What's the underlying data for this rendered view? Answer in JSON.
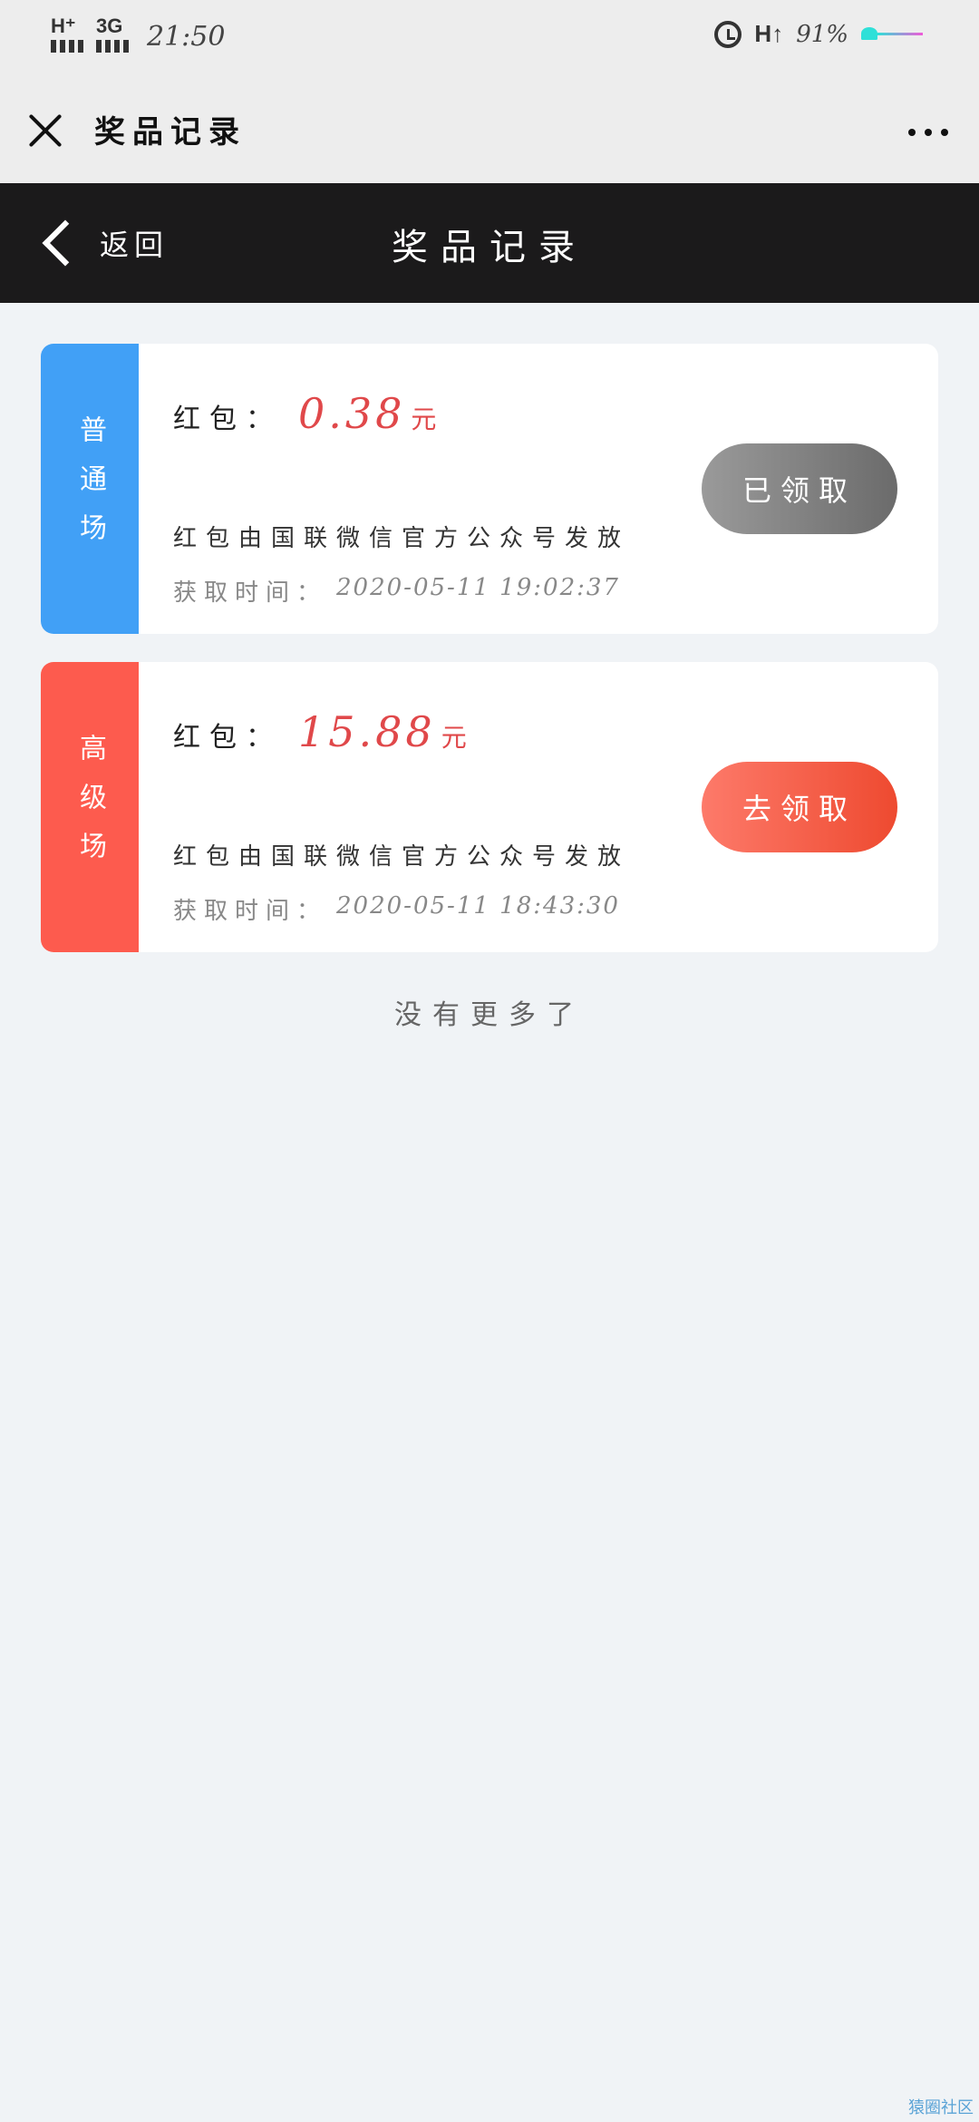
{
  "status_bar": {
    "signal1_label": "H⁺",
    "signal2_label": "3G",
    "time": "21:50",
    "network": "H↑",
    "battery": "91%"
  },
  "titlebar": {
    "title": "奖品记录",
    "close_icon": "close-icon",
    "more_icon": "more-icon"
  },
  "header": {
    "back_label": "返回",
    "title": "奖品记录"
  },
  "records": [
    {
      "tier": "普通场",
      "tier_color": "#41a0f6",
      "amount_label": "红包：",
      "amount": "0.38",
      "unit": "元",
      "issuer": "红包由国联微信官方公众号发放",
      "time_label": "获取时间：",
      "time": "2020-05-11 19:02:37",
      "button": "已领取",
      "button_state": "claimed"
    },
    {
      "tier": "高级场",
      "tier_color": "#fd5b4e",
      "amount_label": "红包：",
      "amount": "15.88",
      "unit": "元",
      "issuer": "红包由国联微信官方公众号发放",
      "time_label": "获取时间：",
      "time": "2020-05-11 18:43:30",
      "button": "去领取",
      "button_state": "unclaimed"
    }
  ],
  "footer": {
    "no_more": "没有更多了"
  },
  "watermark": "猿圈社区",
  "colors": {
    "accent_red": "#e0484a",
    "header_bg": "#1b1a1b",
    "page_bg": "#f0f3f6"
  }
}
